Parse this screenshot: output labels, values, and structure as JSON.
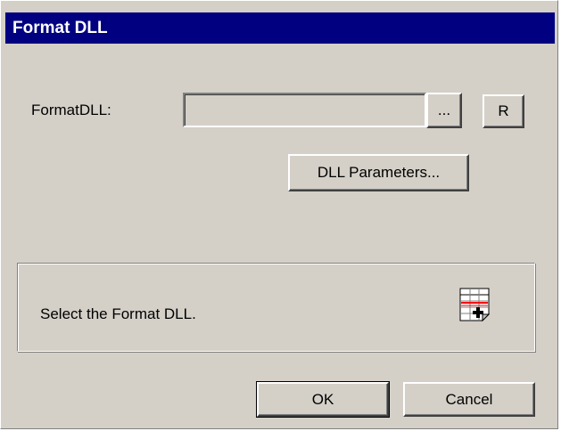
{
  "window": {
    "title": "Format DLL"
  },
  "form": {
    "format_dll_label": "FormatDLL:",
    "format_dll_value": "",
    "browse_label": "...",
    "r_label": "R",
    "dll_params_label": "DLL Parameters..."
  },
  "info": {
    "message": "Select the Format DLL.",
    "icon": "table-format-icon"
  },
  "footer": {
    "ok_label": "OK",
    "cancel_label": "Cancel"
  },
  "colors": {
    "titlebar": "#000080",
    "face": "#d4d0c8",
    "icon_accent": "#ff0000"
  }
}
